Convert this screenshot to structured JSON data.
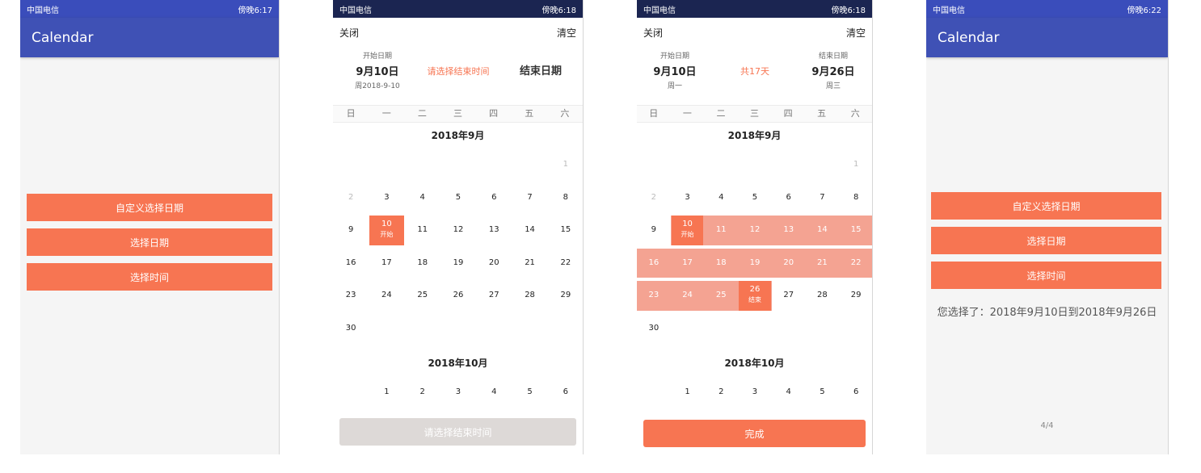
{
  "status": {
    "carrier": "中国电信",
    "time_1": "傍晚6:17",
    "time_2": "傍晚6:18",
    "time_3": "傍晚6:18",
    "time_4": "傍晚6:22"
  },
  "home": {
    "title": "Calendar",
    "buttons": [
      "自定义选择日期",
      "选择日期",
      "选择时间"
    ],
    "result": "您选择了：2018年9月10日到2018年9月26日",
    "pager": "4/4"
  },
  "picker": {
    "close": "关闭",
    "clear": "清空",
    "start_label": "开始日期",
    "end_label": "结束日期",
    "start_date": "9月10日",
    "start_week_1": "周2018-9-10",
    "start_week_2": "周一",
    "end_date": "9月26日",
    "end_week": "周三",
    "choose_end_hint": "请选择结束时间",
    "end_placeholder": "结束日期",
    "total_days": "共17天",
    "weekdays": [
      "日",
      "一",
      "二",
      "三",
      "四",
      "五",
      "六"
    ],
    "month_1": "2018年9月",
    "month_2": "2018年10月",
    "start_tag": "开始",
    "end_tag": "结束",
    "submit_disabled": "请选择结束时间",
    "submit_done": "完成"
  },
  "colors": {
    "accent": "#f77552",
    "range": "#f4a392",
    "appbar": "#3f51b5"
  }
}
